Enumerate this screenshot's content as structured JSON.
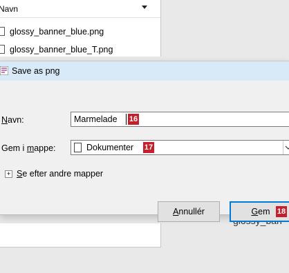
{
  "background": {
    "column_header": "Navn",
    "files": [
      "glossy_banner_blue.png",
      "glossy_banner_blue_T.png"
    ],
    "caption": "glossy_ban"
  },
  "dialog": {
    "title": "Save as png",
    "name_label_prefix": "N",
    "name_label_rest": "avn:",
    "name_value": "Marmelade",
    "name_badge": "16",
    "folder_label_prefix": "Gem i ",
    "folder_label_underlined": "m",
    "folder_label_rest": "appe:",
    "folder_value": "Dokumenter",
    "folder_badge": "17",
    "browse_other_underlined": "S",
    "browse_other_rest": "e efter andre mapper",
    "cancel_underlined": "A",
    "cancel_rest": "nnullér",
    "save_underlined": "G",
    "save_rest": "em",
    "save_badge": "18"
  },
  "colors": {
    "titlebar": "#d8e9f7",
    "badge": "#c41f2a",
    "save_focus": "#0078d7"
  }
}
